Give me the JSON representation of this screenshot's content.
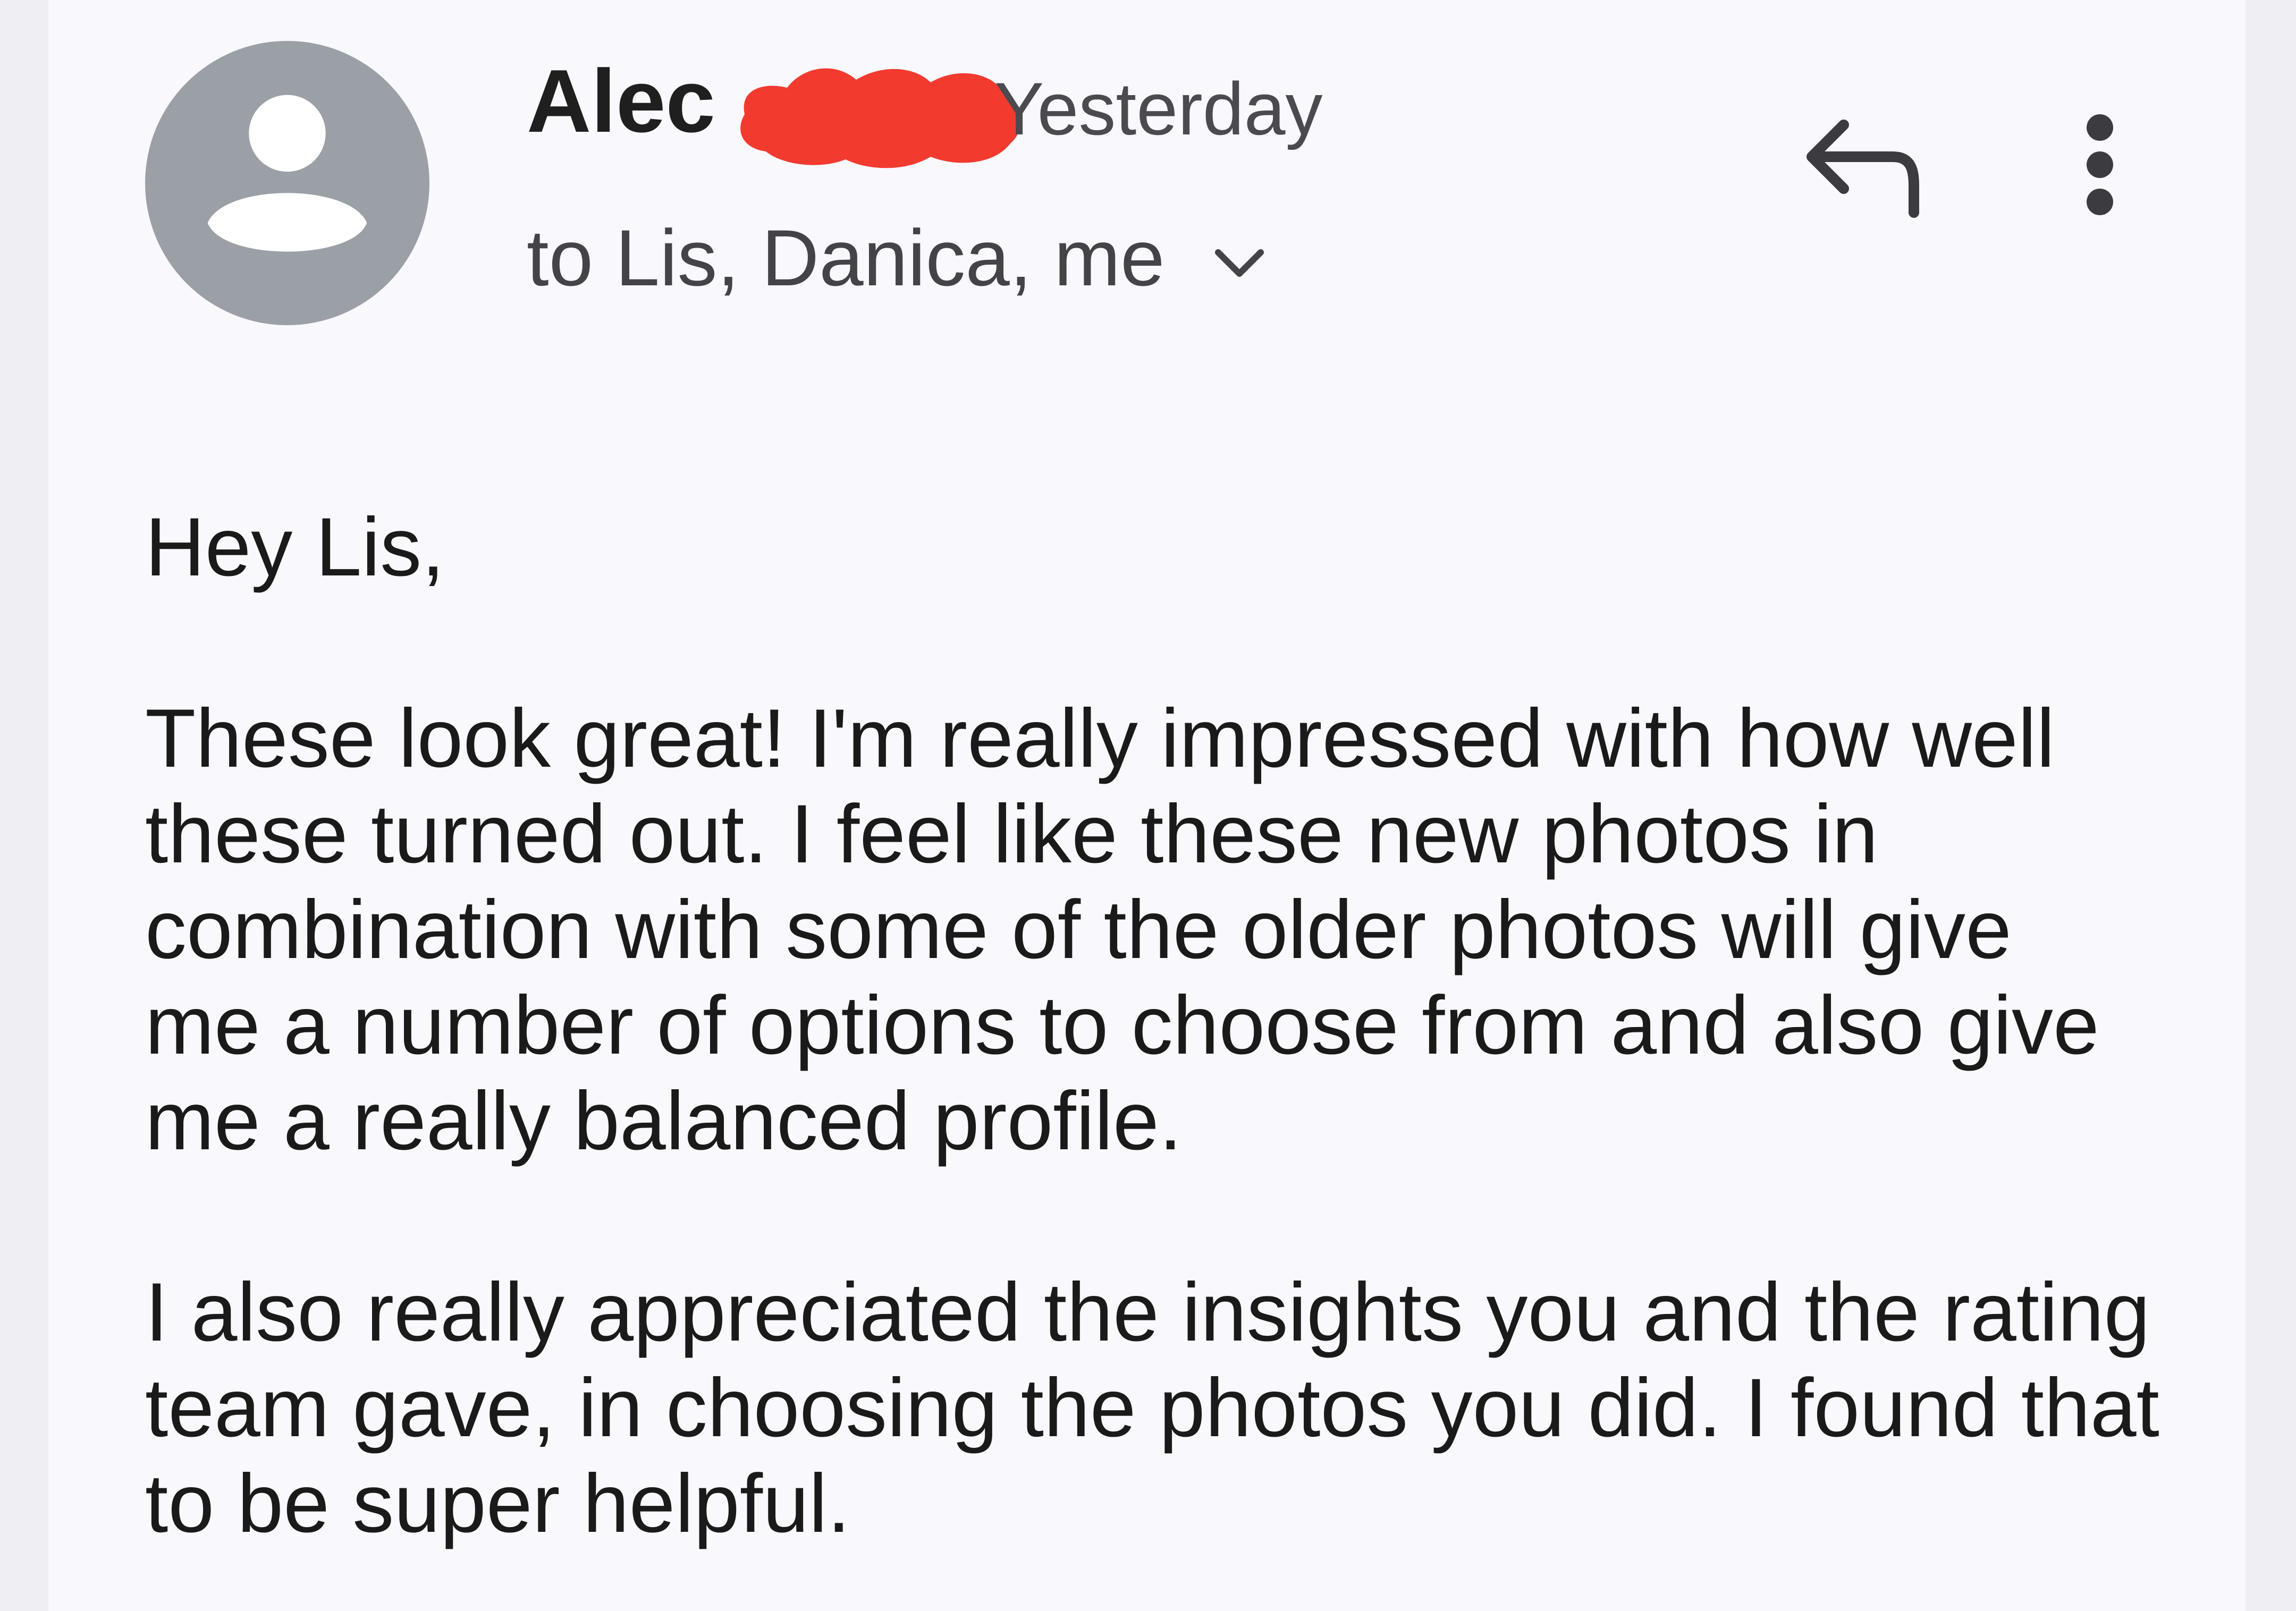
{
  "email": {
    "sender_name": "Alec",
    "time": "Yesterday",
    "recipients": "to Lis, Danica, me",
    "greeting": "Hey Lis,",
    "paragraphs": [
      "These look great! I'm really impressed with how well\nthese turned out. I feel like these new photos in\ncombination with some of the older photos will give\nme a number of options to choose from and also give\nme a really balanced profile.",
      "I also really appreciated the insights you and the rating\nteam gave, in choosing the photos you did. I found that\nto be super helpful."
    ]
  },
  "icons": {
    "avatar": "person-avatar-icon",
    "recipients_toggle": "chevron-down-icon",
    "reply": "reply-icon",
    "more": "more-vert-icon"
  },
  "colors": {
    "avatar_bg": "#9aa0a6",
    "redaction": "#f23a2f",
    "card_bg": "#f8f8fd",
    "text": "#1a1a1a",
    "muted_text": "#444448"
  }
}
